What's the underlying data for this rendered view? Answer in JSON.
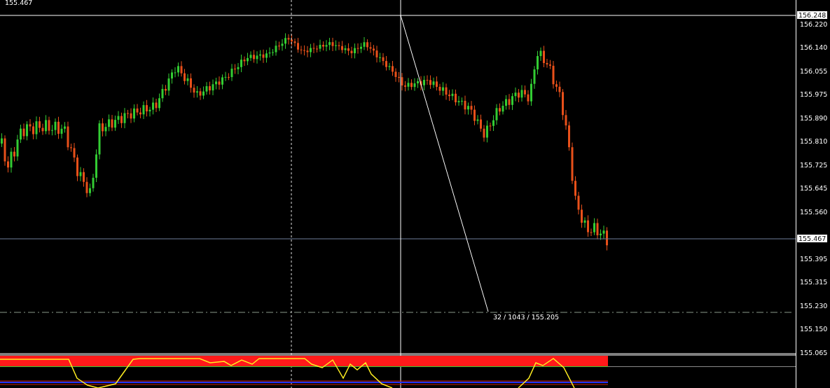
{
  "chart": {
    "price_label": "155.467",
    "axis_labels": [
      "156.220",
      "156.140",
      "156.055",
      "155.975",
      "155.890",
      "155.810",
      "155.725",
      "155.645",
      "155.560",
      "155.395",
      "155.315",
      "155.230",
      "155.150",
      "155.065"
    ],
    "crosshair_price_tag": "156.248",
    "current_price_tag": "155.467",
    "crosshair_readout": "32 / 1043 / 155.205"
  }
}
